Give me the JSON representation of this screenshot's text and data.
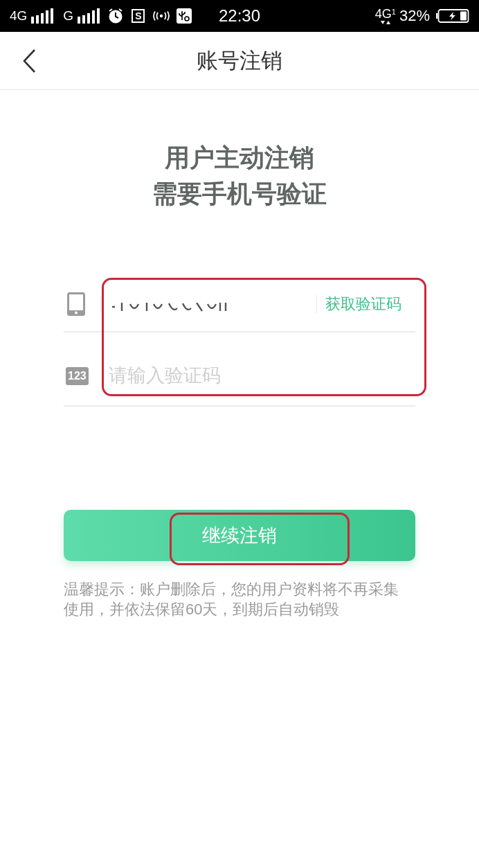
{
  "status_bar": {
    "network_1": "4G",
    "network_2": "G",
    "app_badge": "S",
    "time": "22:30",
    "network_3": "4G",
    "sim_slot": "1",
    "battery_percent": "32%"
  },
  "nav_bar": {
    "title": "账号注销"
  },
  "heading": [
    "用户主动注销",
    "需要手机号验证"
  ],
  "form": {
    "highlighted": true,
    "phone_field": {
      "get_code_link": "获取验证码"
    },
    "code_field": {
      "icon_text": "123",
      "placeholder": "请输入验证码"
    }
  },
  "continue_button": {
    "label": "继续注销",
    "highlighted": true
  },
  "notice": "温馨提示：账户删除后，您的用户资料将不再采集使用，并依法保留60天，到期后自动销毁"
}
